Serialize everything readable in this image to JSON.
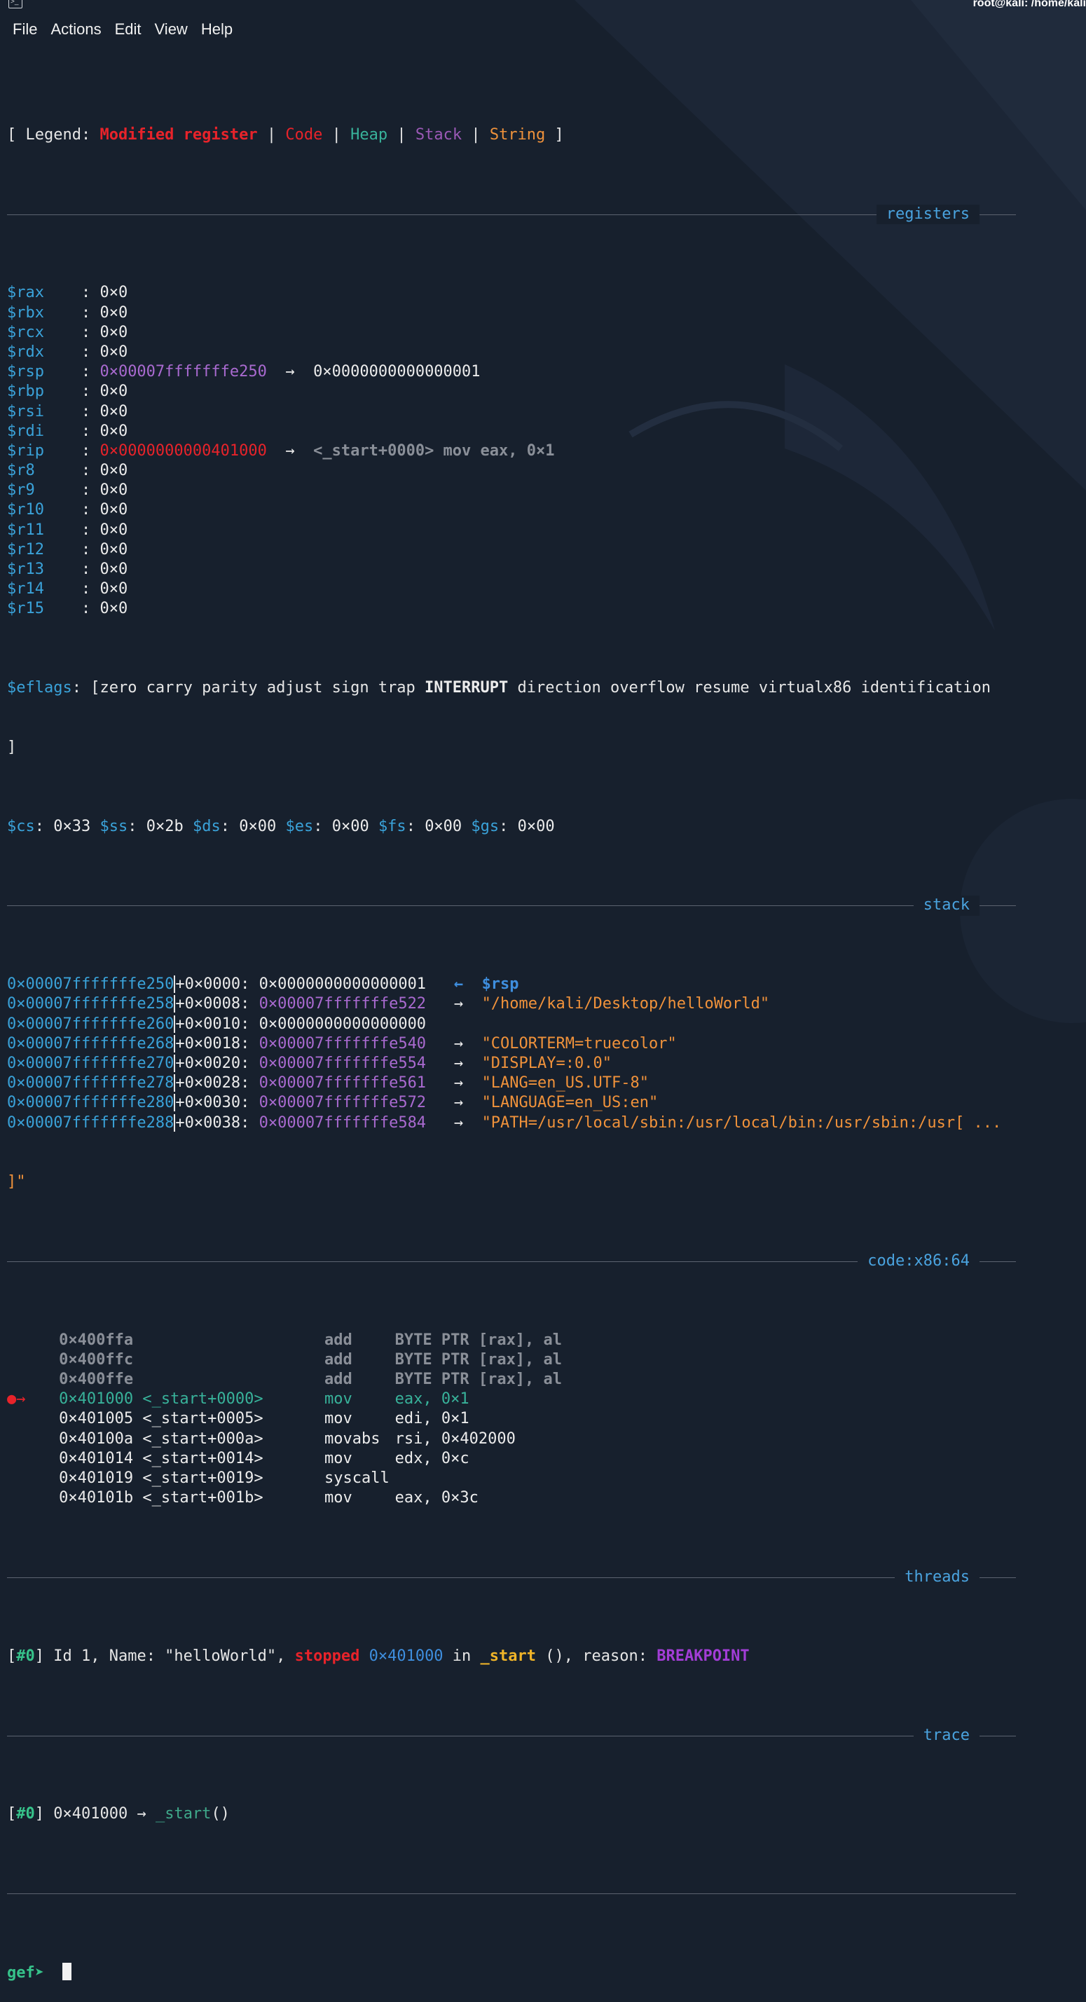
{
  "window": {
    "title": "root@kali: /home/kali"
  },
  "menu": [
    "File",
    "Actions",
    "Edit",
    "View",
    "Help"
  ],
  "legend": {
    "open": "[ Legend: ",
    "modified": "Modified register",
    "code": "Code",
    "heap": "Heap",
    "stack": "Stack",
    "string": "String",
    "pipe": " | ",
    "close": " ]"
  },
  "sections": {
    "registers": "registers",
    "stack": "stack",
    "code": "code:x86:64",
    "threads": "threads",
    "trace": "trace"
  },
  "registers": [
    {
      "name": "$rax",
      "value": "0×0"
    },
    {
      "name": "$rbx",
      "value": "0×0"
    },
    {
      "name": "$rcx",
      "value": "0×0"
    },
    {
      "name": "$rdx",
      "value": "0×0"
    },
    {
      "name": "$rsp",
      "value": "0×00007fffffffe250",
      "arrow": "→",
      "target": "0×0000000000000001"
    },
    {
      "name": "$rbp",
      "value": "0×0"
    },
    {
      "name": "$rsi",
      "value": "0×0"
    },
    {
      "name": "$rdi",
      "value": "0×0"
    },
    {
      "name": "$rip",
      "value": "0×0000000000401000",
      "arrow": "→",
      "target": "<_start+0000> mov eax, 0×1"
    },
    {
      "name": "$r8",
      "value": "0×0"
    },
    {
      "name": "$r9",
      "value": "0×0"
    },
    {
      "name": "$r10",
      "value": "0×0"
    },
    {
      "name": "$r11",
      "value": "0×0"
    },
    {
      "name": "$r12",
      "value": "0×0"
    },
    {
      "name": "$r13",
      "value": "0×0"
    },
    {
      "name": "$r14",
      "value": "0×0"
    },
    {
      "name": "$r15",
      "value": "0×0"
    }
  ],
  "eflags": {
    "label": "$eflags",
    "before": "[zero carry parity adjust sign trap ",
    "bold": "INTERRUPT",
    "after": " direction overflow resume virtualx86 identification",
    "close": "]"
  },
  "segments": [
    {
      "name": "$cs",
      "value": "0×33"
    },
    {
      "name": "$ss",
      "value": "0×2b"
    },
    {
      "name": "$ds",
      "value": "0×00"
    },
    {
      "name": "$es",
      "value": "0×00"
    },
    {
      "name": "$fs",
      "value": "0×00"
    },
    {
      "name": "$gs",
      "value": "0×00"
    }
  ],
  "stack": [
    {
      "addr": "0×00007fffffffe250",
      "offset": "+0×0000:",
      "value": "0×0000000000000001",
      "arrow": "←",
      "target": "$rsp"
    },
    {
      "addr": "0×00007fffffffe258",
      "offset": "+0×0008:",
      "value": "0×00007fffffffe522",
      "arrow": "→",
      "target": "\"/home/kali/Desktop/helloWorld\""
    },
    {
      "addr": "0×00007fffffffe260",
      "offset": "+0×0010:",
      "value": "0×0000000000000000"
    },
    {
      "addr": "0×00007fffffffe268",
      "offset": "+0×0018:",
      "value": "0×00007fffffffe540",
      "arrow": "→",
      "target": "\"COLORTERM=truecolor\""
    },
    {
      "addr": "0×00007fffffffe270",
      "offset": "+0×0020:",
      "value": "0×00007fffffffe554",
      "arrow": "→",
      "target": "\"DISPLAY=:0.0\""
    },
    {
      "addr": "0×00007fffffffe278",
      "offset": "+0×0028:",
      "value": "0×00007fffffffe561",
      "arrow": "→",
      "target": "\"LANG=en_US.UTF-8\""
    },
    {
      "addr": "0×00007fffffffe280",
      "offset": "+0×0030:",
      "value": "0×00007fffffffe572",
      "arrow": "→",
      "target": "\"LANGUAGE=en_US:en\""
    },
    {
      "addr": "0×00007fffffffe288",
      "offset": "+0×0038:",
      "value": "0×00007fffffffe584",
      "arrow": "→",
      "target": "\"PATH=/usr/local/sbin:/usr/local/bin:/usr/sbin:/usr[ ..."
    }
  ],
  "stack_wrap": "]\"",
  "code": [
    {
      "marker": "",
      "addr": "0×400ffa",
      "sym": "",
      "mnem": "add",
      "ops": "BYTE PTR [rax], al",
      "state": "past"
    },
    {
      "marker": "",
      "addr": "0×400ffc",
      "sym": "",
      "mnem": "add",
      "ops": "BYTE PTR [rax], al",
      "state": "past"
    },
    {
      "marker": "",
      "addr": "0×400ffe",
      "sym": "",
      "mnem": "add",
      "ops": "BYTE PTR [rax], al",
      "state": "past"
    },
    {
      "marker": "●→",
      "addr": "0×401000",
      "sym": "<_start+0000>",
      "mnem": "mov",
      "ops": "eax, 0×1",
      "state": "current"
    },
    {
      "marker": "",
      "addr": "0×401005",
      "sym": "<_start+0005>",
      "mnem": "mov",
      "ops": "edi, 0×1",
      "state": "next"
    },
    {
      "marker": "",
      "addr": "0×40100a",
      "sym": "<_start+000a>",
      "mnem": "movabs",
      "ops": "rsi, 0×402000",
      "state": "next"
    },
    {
      "marker": "",
      "addr": "0×401014",
      "sym": "<_start+0014>",
      "mnem": "mov",
      "ops": "edx, 0×c",
      "state": "next"
    },
    {
      "marker": "",
      "addr": "0×401019",
      "sym": "<_start+0019>",
      "mnem": "syscall",
      "ops": "",
      "state": "next"
    },
    {
      "marker": "",
      "addr": "0×40101b",
      "sym": "<_start+001b>",
      "mnem": "mov",
      "ops": "eax, 0×3c",
      "state": "next"
    }
  ],
  "thread": {
    "open": "[",
    "id": "#0",
    "close": "]",
    "text1": " Id 1, Name: \"helloWorld\", ",
    "status": "stopped",
    "addr": "0×401000",
    "text2": " in ",
    "func": "_start",
    "text3": " (), reason: ",
    "reason": "BREAKPOINT"
  },
  "trace": {
    "open": "[",
    "id": "#0",
    "close": "]",
    "text": " 0×401000 → ",
    "func": "_start",
    "tail": "()"
  },
  "prompt": {
    "label": "gef➤"
  },
  "colors": {
    "background": "#17202d",
    "modified": "#e8232a",
    "code": "#e8232a",
    "heap": "#38b29a",
    "stack": "#9b59b6",
    "string": "#f0923b",
    "section": "#4aa3df"
  }
}
